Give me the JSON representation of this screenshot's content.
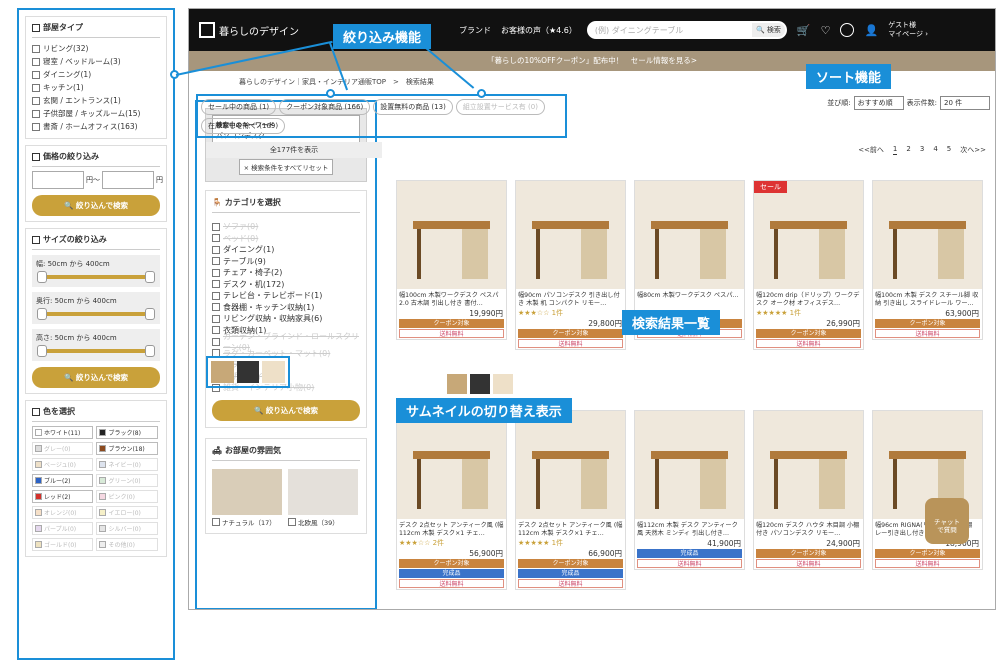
{
  "left": {
    "room_title": "部屋タイプ",
    "rooms": [
      "リビング(32)",
      "寝室 / ベッドルーム(3)",
      "ダイニング(1)",
      "キッチン(1)",
      "玄関 / エントランス(1)",
      "子供部屋 / キッズルーム(15)",
      "書斎 / ホームオフィス(163)"
    ],
    "price_title": "価格の絞り込み",
    "price_sep": "円〜",
    "price_unit": "円",
    "filter_btn": "絞り込んで検索",
    "size_title": "サイズの絞り込み",
    "sizes": [
      "幅:  50cm  から  400cm",
      "奥行:  50cm  から  400cm",
      "高さ:  50cm  から  400cm"
    ],
    "color_title": "色を選択",
    "colors": [
      {
        "label": "ホワイト(11)",
        "hex": "#ffffff",
        "dis": false
      },
      {
        "label": "ブラック(8)",
        "hex": "#222222",
        "dis": false
      },
      {
        "label": "グレー(0)",
        "hex": "#dddddd",
        "dis": true
      },
      {
        "label": "ブラウン(18)",
        "hex": "#8b4a1f",
        "dis": false
      },
      {
        "label": "ベージュ(0)",
        "hex": "#eee0c8",
        "dis": true
      },
      {
        "label": "ネイビー(0)",
        "hex": "#dde3ee",
        "dis": true
      },
      {
        "label": "ブルー(2)",
        "hex": "#2b62c6",
        "dis": false
      },
      {
        "label": "グリーン(0)",
        "hex": "#d8ead8",
        "dis": true
      },
      {
        "label": "レッド(2)",
        "hex": "#d3302a",
        "dis": false
      },
      {
        "label": "ピンク(0)",
        "hex": "#f5d8e2",
        "dis": true
      },
      {
        "label": "オレンジ(0)",
        "hex": "#f6e0c8",
        "dis": true
      },
      {
        "label": "イエロー(0)",
        "hex": "#f6f0c8",
        "dis": true
      },
      {
        "label": "パープル(0)",
        "hex": "#e5d8ee",
        "dis": true
      },
      {
        "label": "シルバー(0)",
        "hex": "#e5e5e5",
        "dis": true
      },
      {
        "label": "ゴールド(0)",
        "hex": "#eee2c0",
        "dis": true
      },
      {
        "label": "その他(0)",
        "hex": "#eeeeee",
        "dis": true
      }
    ]
  },
  "header": {
    "logo": "暮らしのデザイン",
    "nav1": "ブランド",
    "nav2": "お客様の声（★4.6）",
    "search_placeholder": "(例) ダイニングテーブル",
    "search_btn": "検索",
    "cart_count": "0",
    "guest": "ゲスト様",
    "mypage": "マイページ ›"
  },
  "banner": "「暮らしの10%OFFクーポン」配布中！　セール情報を見る>",
  "breadcrumb": "暮らしのデザイン｜家具・インテリア通販TOP　>　検索結果",
  "filter": {
    "kw_title": "検索中のキーワード",
    "kw_value": "パソコンデスク",
    "reset": "×  検索条件をすべてリセット",
    "cat_title": "カテゴリを選択",
    "cats": [
      {
        "l": "ソファ(0)",
        "d": true
      },
      {
        "l": "ベッド(0)",
        "d": true
      },
      {
        "l": "ダイニング(1)",
        "d": false
      },
      {
        "l": "テーブル(9)",
        "d": false
      },
      {
        "l": "チェア・椅子(2)",
        "d": false
      },
      {
        "l": "デスク・机(172)",
        "d": false
      },
      {
        "l": "テレビ台・テレビボード(1)",
        "d": false
      },
      {
        "l": "食器棚・キッチン収納(1)",
        "d": false
      },
      {
        "l": "リビング収納・収納家具(6)",
        "d": false
      },
      {
        "l": "衣類収納(1)",
        "d": false
      },
      {
        "l": "カーテン・ブラインド・ロールスクリーン(0)",
        "d": true
      },
      {
        "l": "ラグ・カーペット・マット(0)",
        "d": true
      },
      {
        "l": "ミラー(0)",
        "d": true
      },
      {
        "l": "照明・ライト(0)",
        "d": true
      },
      {
        "l": "雑貨・インテリア小物(0)",
        "d": true
      }
    ],
    "btn": "絞り込んで検索",
    "room_title": "お部屋の雰囲気",
    "rooms": [
      "ナチュラル（17）",
      "北欧風（39）"
    ]
  },
  "tabs": [
    {
      "l": "セール中の商品 (1)",
      "d": false
    },
    {
      "l": "クーポン対象商品 (166)",
      "d": false
    },
    {
      "l": "設置無料の商品 (13)",
      "d": false
    },
    {
      "l": "組立設置サービス有 (0)",
      "d": true
    },
    {
      "l": "在庫なしを除く (169)",
      "d": false
    }
  ],
  "sort": {
    "label": "並び順:",
    "value": "おすすめ順",
    "per_label": "表示件数:",
    "per_value": "20 件"
  },
  "count": "全177件を表示",
  "pager": [
    "<<前へ",
    "1",
    "2",
    "3",
    "4",
    "5",
    "次へ>>"
  ],
  "products": [
    {
      "name": "幅100cm 木製ワークデスク ペスパ2.0 古木調 引出し付き 書付…",
      "price": "19,990円",
      "stars": "",
      "tags": [
        [
          "クーポン対象",
          "c"
        ],
        [
          "送料無料",
          "f"
        ]
      ]
    },
    {
      "name": "幅90cm パソコンデスク 引き出し付き 木製 机 コンパクト リモー…",
      "price": "29,800円",
      "stars": "★★★☆☆ 1件",
      "tags": [
        [
          "クーポン対象",
          "c"
        ],
        [
          "送料無料",
          "f"
        ]
      ]
    },
    {
      "name": "幅80cm 木製ワークデスク ペスパ…",
      "price": "",
      "stars": "",
      "tags": [
        [
          "クーポン対象",
          "c"
        ],
        [
          "送料無料",
          "f"
        ]
      ]
    },
    {
      "name": "幅120cm drip（ドリップ）ワークデスク オーク材 オフィスデス…",
      "price": "26,990円",
      "stars": "★★★★★ 1件",
      "sale": "セール",
      "tags": [
        [
          "クーポン対象",
          "c"
        ],
        [
          "送料無料",
          "f"
        ]
      ]
    },
    {
      "name": "幅100cm 木製 デスク スチール脚 収納 引き出し スライドレール ワー…",
      "price": "63,900円",
      "stars": "",
      "tags": [
        [
          "クーポン対象",
          "c"
        ],
        [
          "送料無料",
          "f"
        ]
      ]
    },
    {
      "name": "デスク 2点セット アンティーク風 (幅112cm 木製 デスク×1 チェ…",
      "price": "56,900円",
      "stars": "★★★☆☆ 2件",
      "tags": [
        [
          "クーポン対象",
          "c"
        ],
        [
          "完成品",
          "s"
        ],
        [
          "送料無料",
          "f"
        ]
      ]
    },
    {
      "name": "デスク 2点セット アンティーク風 (幅112cm 木製 デスク×1 チェ…",
      "price": "66,900円",
      "stars": "★★★★★ 1件",
      "tags": [
        [
          "クーポン対象",
          "c"
        ],
        [
          "完成品",
          "s"
        ],
        [
          "送料無料",
          "f"
        ]
      ]
    },
    {
      "name": "幅112cm 木製 デスク アンティーク風 天然木 ミンディ 引出し付き…",
      "price": "41,900円",
      "stars": "",
      "tags": [
        [
          "完成品",
          "s"
        ],
        [
          "送料無料",
          "f"
        ]
      ]
    },
    {
      "name": "幅120cm デスク ハウタ 木目調 小棚付き パソコンデスク リモー…",
      "price": "24,900円",
      "stars": "",
      "tags": [
        [
          "クーポン対象",
          "c"
        ],
        [
          "送料無料",
          "f"
        ]
      ]
    },
    {
      "name": "幅96cm RIGNA(リグナ) デスク 棚 レー引き出し付き…",
      "price": "18,900円",
      "stars": "",
      "tags": [
        [
          "クーポン対象",
          "c"
        ],
        [
          "送料無料",
          "f"
        ]
      ]
    }
  ],
  "labels": {
    "filter": "絞り込み機能",
    "sort": "ソート機能",
    "results": "検索結果一覧",
    "thumbs": "サムネイルの切り替え表示"
  },
  "chat": "チャット\nで質問"
}
